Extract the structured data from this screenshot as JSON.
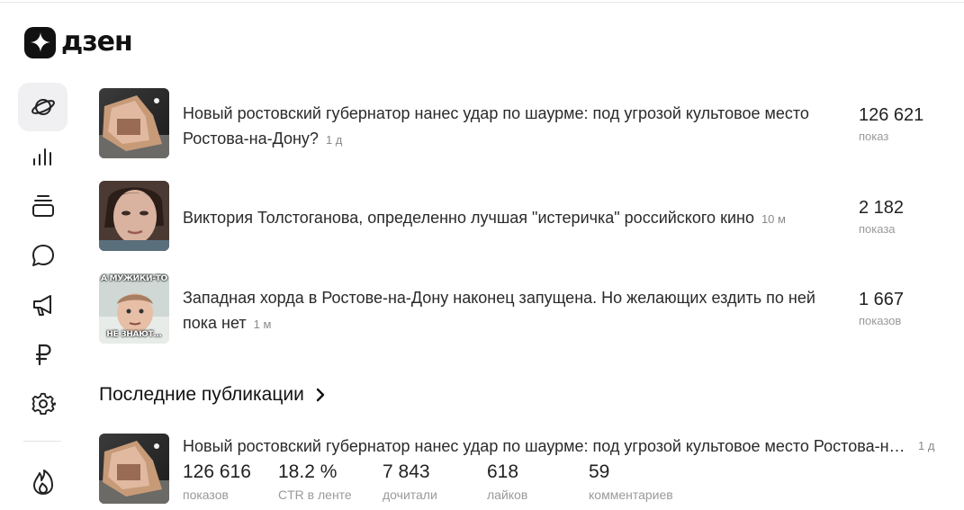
{
  "brand": {
    "name": "дзен",
    "logo_icon": "dzen-star-icon"
  },
  "sidebar": {
    "items": [
      {
        "name": "planet-icon",
        "active": true
      },
      {
        "name": "stats-bars-icon",
        "active": false
      },
      {
        "name": "publications-stack-icon",
        "active": false
      },
      {
        "name": "comments-bubble-icon",
        "active": false
      },
      {
        "name": "megaphone-icon",
        "active": false
      },
      {
        "name": "ruble-icon",
        "active": false
      },
      {
        "name": "gear-icon",
        "active": false
      },
      {
        "name": "flame-icon",
        "active": false
      }
    ]
  },
  "top_items": [
    {
      "title": "Новый ростовский губернатор нанес удар по шаурме: под угрозой культовое место Ростова-на-Дону?",
      "age": "1 д",
      "views": "126 621",
      "views_label": "показ"
    },
    {
      "title": "Виктория Толстоганова, определенно лучшая \"истеричка\" российского кино",
      "age": "10 м",
      "views": "2 182",
      "views_label": "показа"
    },
    {
      "title": "Западная хорда в Ростове-на-Дону наконец запущена. Но желающих ездить по ней пока нет",
      "age": "1 м",
      "views": "1 667",
      "views_label": "показов",
      "meme_top": "А МУЖИКИ-ТО",
      "meme_bottom": "НЕ ЗНАЮТ..."
    }
  ],
  "latest": {
    "section_title": "Последние публикации",
    "item": {
      "title": "Новый ростовский губернатор нанес удар по шаурме: под угрозой культовое место Ростова-на-Дону?",
      "age": "1 д",
      "stats": [
        {
          "value": "126 616",
          "label": "показов"
        },
        {
          "value": "18.2 %",
          "label": "CTR в ленте"
        },
        {
          "value": "7 843",
          "label": "дочитали"
        },
        {
          "value": "618",
          "label": "лайков"
        },
        {
          "value": "59",
          "label": "комментариев"
        }
      ]
    }
  }
}
